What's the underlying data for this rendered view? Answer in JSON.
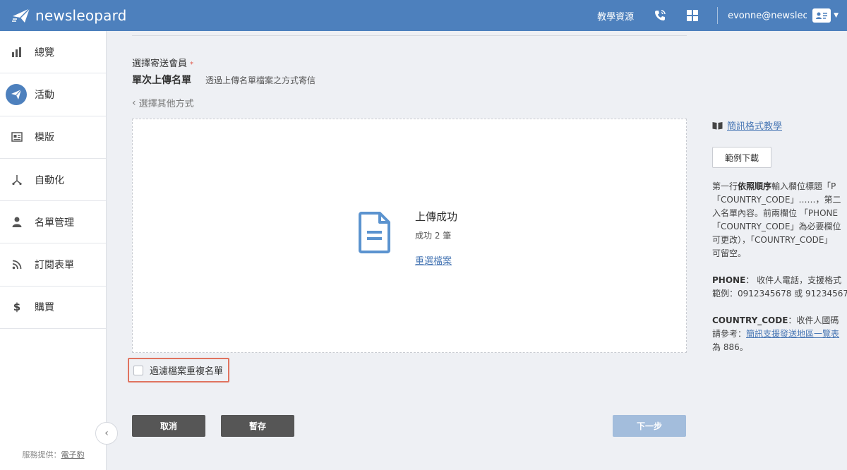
{
  "brand": {
    "name": "newsleopard"
  },
  "topbar": {
    "resources_label": "教學資源",
    "email": "evonne@newsleo..."
  },
  "sidebar": {
    "items": [
      {
        "label": "總覽",
        "icon": "bar-chart-icon"
      },
      {
        "label": "活動",
        "icon": "paper-plane-icon",
        "active": true
      },
      {
        "label": "模版",
        "icon": "template-icon"
      },
      {
        "label": "自動化",
        "icon": "automation-icon"
      },
      {
        "label": "名單管理",
        "icon": "user-icon"
      },
      {
        "label": "訂閱表單",
        "icon": "rss-icon"
      },
      {
        "label": "購買",
        "icon": "dollar-icon"
      }
    ],
    "footer_prefix": "服務提供：",
    "footer_link": "電子豹"
  },
  "form": {
    "section_label": "選擇寄送會員",
    "required_mark": "*",
    "mode_title": "單次上傳名單",
    "mode_desc": "透過上傳名單檔案之方式寄信",
    "back_label": "選擇其他方式"
  },
  "upload": {
    "title": "上傳成功",
    "count": "成功 2 筆",
    "reselect": "重選檔案"
  },
  "filter": {
    "label": "過濾檔案重複名單",
    "checked": false
  },
  "buttons": {
    "cancel": "取消",
    "save": "暫存",
    "next": "下一步"
  },
  "help": {
    "tutorial_link": "簡訊格式教學",
    "sample_download": "範例下載",
    "lines": {
      "l1_a": "第一行",
      "l1_b": "依照順序",
      "l1_c": "輸入欄位標題「P",
      "l2": "「COUNTRY_CODE」……，第二",
      "l3": "入名單內容。前兩欄位 「PHONE",
      "l4": "「COUNTRY_CODE」為必要欄位",
      "l5": "可更改），「COUNTRY_CODE」",
      "l6": "可留空。",
      "phone_key": "PHONE",
      "phone_desc": "： 收件人電話，支援格式",
      "phone_example": "範例：0912345678 或 91234567",
      "cc_key": "COUNTRY_CODE",
      "cc_desc": "：收件人國碼",
      "cc_ref_prefix": "請參考：",
      "cc_ref_link": "簡訊支援發送地區一覽表",
      "cc_default": "為 886。"
    }
  },
  "colors": {
    "primary": "#4d80bd",
    "highlight_border": "#e0735f",
    "button_dark": "#565656",
    "button_disabled": "#a3bddc"
  }
}
